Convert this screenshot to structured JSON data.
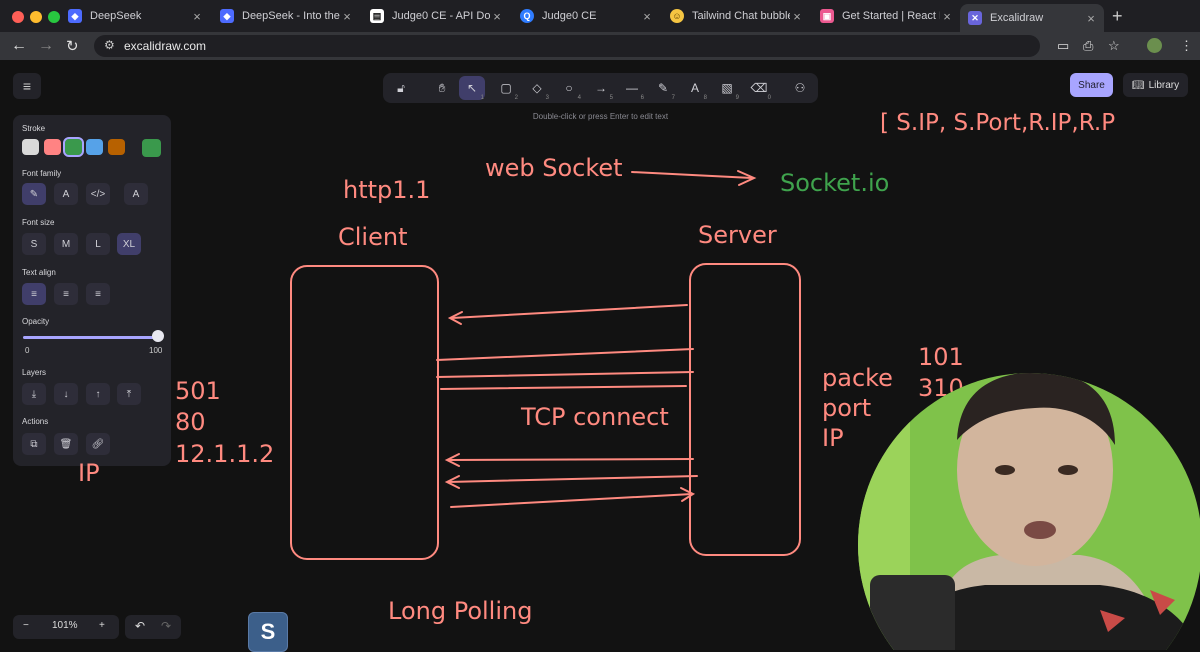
{
  "tabs": [
    {
      "title": "DeepSeek",
      "favicon": "deepseek-icon",
      "color": "#4d6bfe"
    },
    {
      "title": "DeepSeek - Into the",
      "favicon": "deepseek-icon",
      "color": "#4d6bfe"
    },
    {
      "title": "Judge0 CE - API Doc",
      "favicon": "document-icon",
      "color": "#ffffff"
    },
    {
      "title": "Judge0 CE",
      "favicon": "judge0-icon",
      "color": "#2f7cff"
    },
    {
      "title": "Tailwind Chat bubble",
      "favicon": "smiley-icon",
      "color": "#f5c542"
    },
    {
      "title": "Get Started | React H",
      "favicon": "react-hook-form-icon",
      "color": "#ec5990"
    },
    {
      "title": "Excalidraw",
      "favicon": "excalidraw-icon",
      "color": "#6965db"
    }
  ],
  "url": "excalidraw.com",
  "toolbar_hint": "Double-click or press Enter to edit text",
  "share_label": "Share",
  "library_label": "Library",
  "tool_numbers": [
    "1",
    "2",
    "3",
    "4",
    "5",
    "6",
    "7",
    "8",
    "9",
    "0"
  ],
  "panel": {
    "stroke_label": "Stroke",
    "stroke_colors": [
      "#d9d9d9",
      "#ff8383",
      "#3a994c",
      "#56a2e8",
      "#b76100",
      "#3a994c"
    ],
    "font_family_label": "Font family",
    "font_size_label": "Font size",
    "font_sizes": [
      "S",
      "M",
      "L",
      "XL"
    ],
    "text_align_label": "Text align",
    "opacity_label": "Opacity",
    "opacity_min": "0",
    "opacity_max": "100",
    "layers_label": "Layers",
    "actions_label": "Actions"
  },
  "zoom_level": "101%",
  "drawing": {
    "stroke_color": "#ff8a80",
    "green_color": "#3fa34d",
    "top_right_text": "[ S.IP, S.Port,R.IP,R.P",
    "web_socket": "web Socket",
    "socket_io": "Socket.io",
    "http": "http1.1",
    "client": "Client",
    "server": "Server",
    "tcp": "TCP connect",
    "long_polling": "Long Polling",
    "left_numbers": [
      "501",
      "80",
      "12.1.1.2"
    ],
    "left_ip": "IP",
    "packe": "packe",
    "port": "port",
    "ip": "IP",
    "right_numbers": [
      "101",
      "310"
    ]
  }
}
